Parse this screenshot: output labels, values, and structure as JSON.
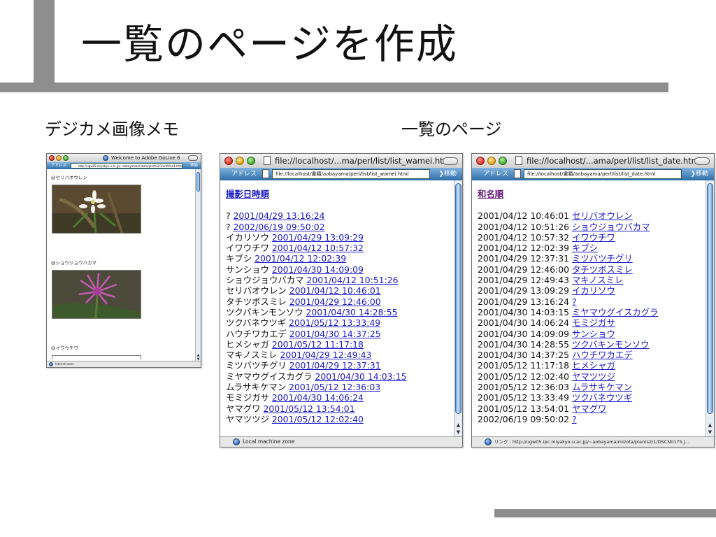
{
  "slide": {
    "title": "一覧のページを作成",
    "left_label": "デジカメ画像メモ",
    "right_label": "一覧のページ"
  },
  "golive_window": {
    "title": "Welcome to Adobe GoLive 6",
    "addr_label": "アドレス",
    "url": "http://ugw05.miyakyo-u.ac.jp/~aobayama/mizota/plants2/1/untitled1.html",
    "go_label": "移動",
    "entries": [
      {
        "label": "@セリバオウレン",
        "photo": "flower-white"
      },
      {
        "label": "@ショウジョウバカマ",
        "photo": "flower-purple"
      },
      {
        "label": "@イワウチワ",
        "photo": "flower-partial"
      }
    ],
    "status": "Internet zone"
  },
  "wamei_window": {
    "title": "file://localhost/...ma/perl/list/list_wamei.html",
    "addr_label": "アドレス",
    "url": "file://localhost/書類/aobayama/perl/list/list_wamei.html",
    "go_label": "移動",
    "heading_link": "撮影日時順",
    "rows": [
      {
        "name": "?",
        "date": "2001/04/29 13:16:24"
      },
      {
        "name": "?",
        "date": "2002/06/19 09:50:02"
      },
      {
        "name": "イカリソウ",
        "date": "2001/04/29 13:09:29"
      },
      {
        "name": "イワウチワ",
        "date": "2001/04/12 10:57:32"
      },
      {
        "name": "キブシ",
        "date": "2001/04/12 12:02:39"
      },
      {
        "name": "サンショウ",
        "date": "2001/04/30 14:09:09"
      },
      {
        "name": "ショウジョウバカマ",
        "date": "2001/04/12 10:51:26"
      },
      {
        "name": "セリバオウレン",
        "date": "2001/04/12 10:46:01"
      },
      {
        "name": "タチツボスミレ",
        "date": "2001/04/29 12:46:00"
      },
      {
        "name": "ツクバキンモンソウ",
        "date": "2001/04/30 14:28:55"
      },
      {
        "name": "ツクバネウツギ",
        "date": "2001/05/12 13:33:49"
      },
      {
        "name": "ハウチワカエデ",
        "date": "2001/04/30 14:37:25"
      },
      {
        "name": "ヒメシャガ",
        "date": "2001/05/12 11:17:18"
      },
      {
        "name": "マキノスミレ",
        "date": "2001/04/29 12:49:43"
      },
      {
        "name": "ミツバツチグリ",
        "date": "2001/04/29 12:37:31"
      },
      {
        "name": "ミヤマウグイスカグラ",
        "date": "2001/04/30 14:03:15"
      },
      {
        "name": "ムラサキケマン",
        "date": "2001/05/12 12:36:03"
      },
      {
        "name": "モミジガサ",
        "date": "2001/04/30 14:06:24"
      },
      {
        "name": "ヤマグワ",
        "date": "2001/05/12 13:54:01"
      },
      {
        "name": "ヤマツツジ",
        "date": "2001/05/12 12:02:40"
      }
    ],
    "status": "Local machine zone"
  },
  "date_window": {
    "title": "file://localhost/...ama/perl/list/list_date.html",
    "addr_label": "アドレス",
    "url": "file://localhost/書類/aobayama/perl/list/list_date.html",
    "go_label": "移動",
    "heading_link": "和名順",
    "rows": [
      {
        "date": "2001/04/12 10:46:01",
        "name": "セリバオウレン"
      },
      {
        "date": "2001/04/12 10:51:26",
        "name": "ショウジョウバカマ"
      },
      {
        "date": "2001/04/12 10:57:32",
        "name": "イワウチワ"
      },
      {
        "date": "2001/04/12 12:02:39",
        "name": "キブシ"
      },
      {
        "date": "2001/04/29 12:37:31",
        "name": "ミツバツチグリ"
      },
      {
        "date": "2001/04/29 12:46:00",
        "name": "タチツボスミレ"
      },
      {
        "date": "2001/04/29 12:49:43",
        "name": "マキノスミレ"
      },
      {
        "date": "2001/04/29 13:09:29",
        "name": "イカリソウ"
      },
      {
        "date": "2001/04/29 13:16:24",
        "name": "?"
      },
      {
        "date": "2001/04/30 14:03:15",
        "name": "ミヤマウグイスカグラ"
      },
      {
        "date": "2001/04/30 14:06:24",
        "name": "モミジガサ"
      },
      {
        "date": "2001/04/30 14:09:09",
        "name": "サンショウ"
      },
      {
        "date": "2001/04/30 14:28:55",
        "name": "ツクバキンモンソウ"
      },
      {
        "date": "2001/04/30 14:37:25",
        "name": "ハウチワカエデ"
      },
      {
        "date": "2001/05/12 11:17:18",
        "name": "ヒメシャガ"
      },
      {
        "date": "2001/05/12 12:02:40",
        "name": "ヤマツツジ"
      },
      {
        "date": "2001/05/12 12:36:03",
        "name": "ムラサキケマン"
      },
      {
        "date": "2001/05/12 13:33:49",
        "name": "ツクバネウツギ"
      },
      {
        "date": "2001/05/12 13:54:01",
        "name": "ヤマグワ"
      },
      {
        "date": "2002/06/19 09:50:02",
        "name": "?"
      }
    ],
    "status": "リンク : http://ugw05.ipc.miyakyo-u.ac.jp/~aobayama/mizota/plants2/1/DSCN0175.J..."
  },
  "colors": {
    "link": "#1a1ac8",
    "visited_link": "#6a1a7a",
    "address_bar": "#2f6ea8",
    "slide_bar": "#8e8e8e"
  }
}
